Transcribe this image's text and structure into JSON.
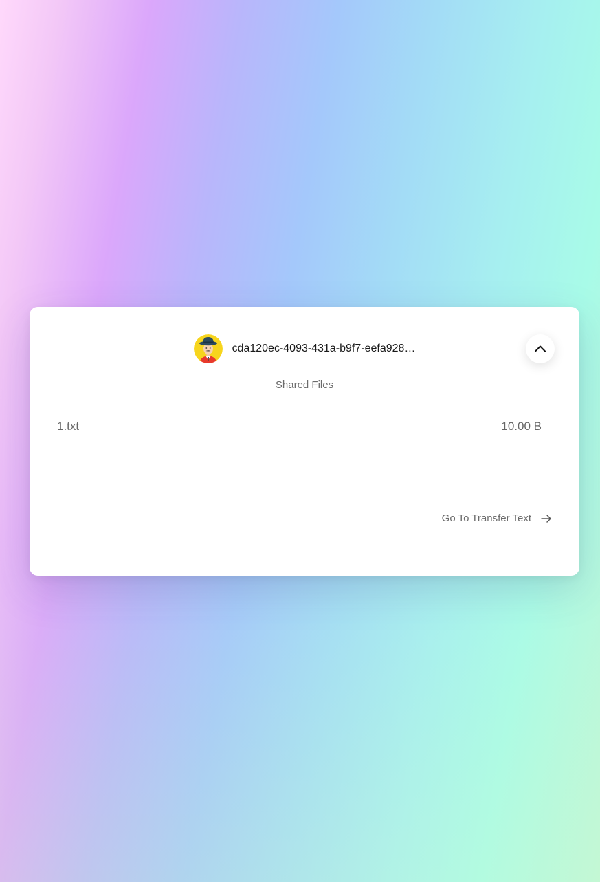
{
  "peer": {
    "id": "cda120ec-4093-431a-b9f7-eefa928…",
    "avatar_icon": "person-with-hat-avatar"
  },
  "panel": {
    "collapse_icon": "chevron-up-icon",
    "section_title": "Shared Files"
  },
  "files": [
    {
      "name": "1.txt",
      "size": "10.00 B"
    }
  ],
  "footer": {
    "link_label": "Go To Transfer Text",
    "link_icon": "arrow-right-icon"
  }
}
